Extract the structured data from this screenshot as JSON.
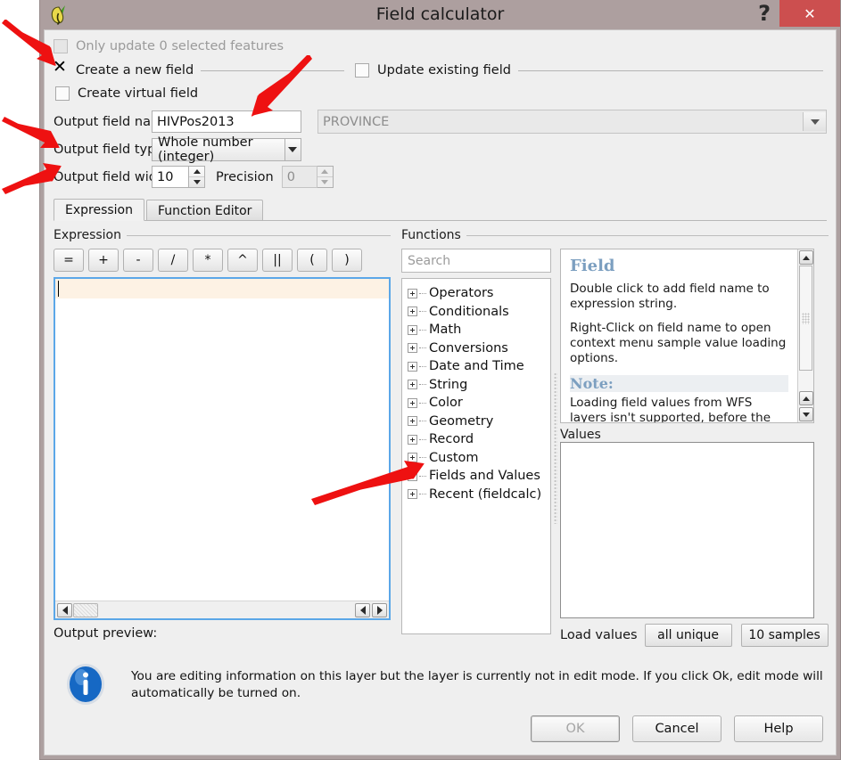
{
  "window": {
    "title": "Field calculator",
    "app_icon": "qgis-leaf-icon",
    "help_icon": "question-mark-icon",
    "close_icon": "close-x-icon",
    "titlebar_color": "#ad9f9f",
    "close_button_color": "#cc4f4f"
  },
  "options": {
    "only_update_selected_label": "Only update 0 selected features",
    "only_update_selected_checked": false,
    "only_update_selected_enabled": false,
    "create_new_field_label": "Create a new field",
    "create_new_field_checked": true,
    "create_virtual_field_label": "Create virtual field",
    "create_virtual_field_checked": false,
    "update_existing_field_label": "Update existing field",
    "update_existing_field_checked": false,
    "existing_field_value": "PROVINCE",
    "existing_field_enabled": false
  },
  "new_field": {
    "name_label": "Output field name",
    "name_value": "HIVPos2013",
    "type_label": "Output field type",
    "type_value": "Whole number (integer)",
    "width_label": "Output field width",
    "width_value": "10",
    "precision_label": "Precision",
    "precision_value": "0"
  },
  "tabs": [
    {
      "label": "Expression",
      "active": true
    },
    {
      "label": "Function Editor",
      "active": false
    }
  ],
  "expression": {
    "group_title": "Expression",
    "operators": [
      "=",
      "+",
      "-",
      "/",
      "*",
      "^",
      "||",
      "(",
      ")"
    ],
    "editor_text": "",
    "output_preview_label": "Output preview:",
    "output_preview_value": ""
  },
  "functions": {
    "group_title": "Functions",
    "search_placeholder": "Search",
    "search_value": "",
    "tree": [
      "Operators",
      "Conditionals",
      "Math",
      "Conversions",
      "Date and Time",
      "String",
      "Color",
      "Geometry",
      "Record",
      "Custom",
      "Fields and Values",
      "Recent (fieldcalc)"
    ]
  },
  "help": {
    "heading": "Field",
    "paragraph1": "Double click to add field name to expression string.",
    "paragraph2": "Right-Click on field name to open context menu sample value loading options.",
    "note_heading": "Note:",
    "note_paragraph": "Loading field values from WFS layers isn't supported, before the layer is actually"
  },
  "values": {
    "label": "Values",
    "items": [],
    "load_values_label": "Load values",
    "all_unique_label": "all unique",
    "ten_samples_label": "10 samples"
  },
  "message": {
    "icon": "info-icon",
    "text": "You are editing information on this layer but the layer is currently not in edit mode. If you click Ok, edit mode will automatically be turned on."
  },
  "buttons": {
    "ok_label": "OK",
    "ok_enabled": false,
    "cancel_label": "Cancel",
    "help_label": "Help"
  },
  "annotations": {
    "arrow_color": "#ee1111",
    "count": 5
  }
}
